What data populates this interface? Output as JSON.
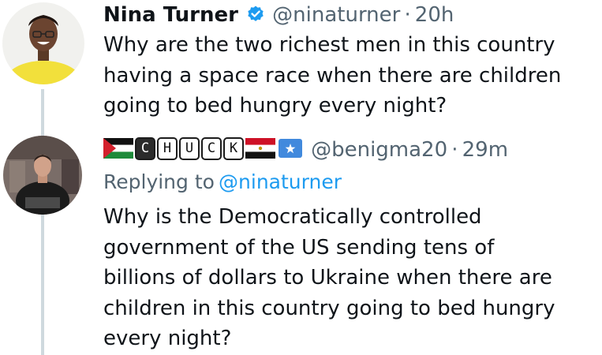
{
  "tweet1": {
    "name": "Nina Turner",
    "handle": "@ninaturner",
    "separator": "·",
    "time": "20h",
    "text_lines": [
      "Why are the two richest men in this country",
      "having a space race when there are children",
      "going to bed hungry every night?"
    ]
  },
  "tweet2": {
    "name_letters": [
      "C",
      "H",
      "U",
      "C",
      "K"
    ],
    "handle": "@benigma20",
    "separator": "·",
    "time": "29m",
    "replying_label": "Replying to",
    "replying_handle": "@ninaturner",
    "text_lines": [
      "Why is the Democratically controlled",
      "government of the US sending tens of",
      "billions of dollars to Ukraine when there are",
      "children in this country going to bed hungry",
      "every night?"
    ]
  },
  "colors": {
    "text": "#0f1419",
    "muted": "#536471",
    "link": "#1d9bf0",
    "verified": "#1d9bf0",
    "thread_line": "#cfd9de"
  },
  "icons": {
    "verified": "verified-badge-icon",
    "flag1": "palestine-flag-icon",
    "flag2": "egypt-flag-icon",
    "flag3": "somalia-flag-icon"
  }
}
